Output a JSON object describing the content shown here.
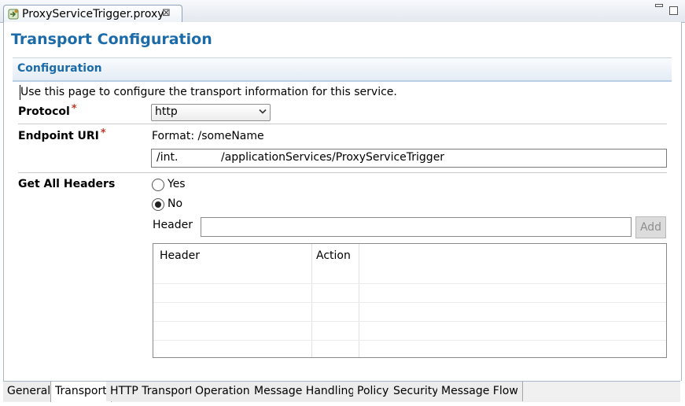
{
  "editor_tab": {
    "title": "ProxyServiceTrigger.proxy",
    "close_symbol": "⊠",
    "icon": "proxy-service-icon"
  },
  "window_controls": {
    "minimize_icon": "minimize-icon",
    "maximize_icon": "maximize-icon"
  },
  "page": {
    "title": "Transport Configuration"
  },
  "section": {
    "title": "Configuration",
    "description": "Use this page to configure the transport information for this service."
  },
  "form": {
    "protocol": {
      "label": "Protocol",
      "required_mark": "*",
      "value": "http"
    },
    "endpoint_uri": {
      "label": "Endpoint URI",
      "required_mark": "*",
      "format_text": "Format:  /someName",
      "value_part1": "/int.",
      "value_part2": "/applicationServices/ProxyServiceTrigger"
    },
    "get_all_headers": {
      "label": "Get All Headers",
      "options": [
        {
          "label": "Yes",
          "selected": false
        },
        {
          "label": "No",
          "selected": true
        }
      ]
    },
    "header_field": {
      "label": "Header",
      "value": "",
      "add_label": "Add"
    },
    "headers_table": {
      "columns": [
        "Header",
        "Action"
      ],
      "rows": []
    }
  },
  "bottom_tabs": [
    {
      "label": "General",
      "active": false
    },
    {
      "label": "Transport",
      "active": true
    },
    {
      "label": "HTTP Transport",
      "active": false
    },
    {
      "label": "Operation",
      "active": false
    },
    {
      "label": "Message Handling",
      "active": false
    },
    {
      "label": "Policy",
      "active": false
    },
    {
      "label": "Security",
      "active": false
    },
    {
      "label": "Message Flow",
      "active": false
    }
  ],
  "colors": {
    "title_blue": "#1c6ba9",
    "required_red": "#c0392b"
  }
}
